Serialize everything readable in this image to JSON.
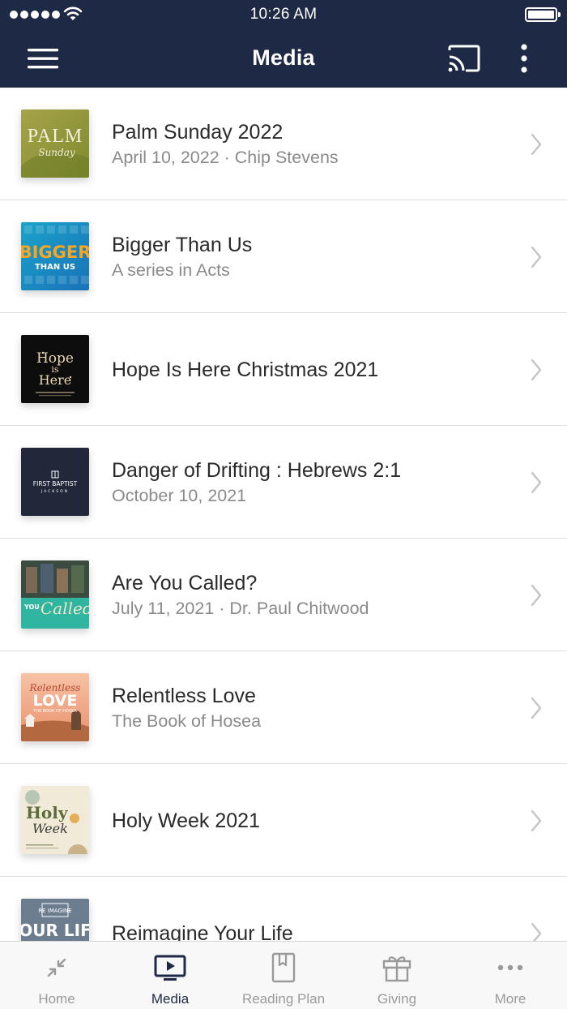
{
  "status_bar": {
    "time": "10:26 AM"
  },
  "nav": {
    "title": "Media"
  },
  "items": [
    {
      "title": "Palm Sunday 2022",
      "subtitle": "April 10, 2022 · Chip Stevens",
      "thumb_text": "PALM",
      "thumb_script": "Sunday"
    },
    {
      "title": "Bigger Than Us",
      "subtitle": "A series in Acts",
      "thumb_text": "BIGGER",
      "thumb_sub": "THAN US"
    },
    {
      "title": "Hope Is Here Christmas 2021",
      "subtitle": "",
      "thumb_text": "Hope",
      "thumb_mid": "is",
      "thumb_script": "Here"
    },
    {
      "title": "Danger of Drifting : Hebrews 2:1",
      "subtitle": "October 10, 2021",
      "thumb_text": "FIRST BAPTIST",
      "thumb_sub": "JACKSON"
    },
    {
      "title": "Are You Called?",
      "subtitle": "July 11, 2021 · Dr. Paul Chitwood",
      "thumb_text": "YOU",
      "thumb_script": "Called"
    },
    {
      "title": "Relentless Love",
      "subtitle": "The Book of Hosea",
      "thumb_script": "Relentless",
      "thumb_text": "LOVE",
      "thumb_sub": "THE BOOK OF HOSEA"
    },
    {
      "title": "Holy Week 2021",
      "subtitle": "",
      "thumb_text": "Holy",
      "thumb_script": "Week"
    },
    {
      "title": "Reimagine Your Life",
      "subtitle": "",
      "thumb_text": "RE IMAGINE",
      "thumb_sub": "OUR LIF"
    }
  ],
  "tabs": [
    {
      "label": "Home",
      "icon": "compress-arrows-icon",
      "active": false
    },
    {
      "label": "Media",
      "icon": "tv-play-icon",
      "active": true
    },
    {
      "label": "Reading Plan",
      "icon": "bookmark-book-icon",
      "active": false
    },
    {
      "label": "Giving",
      "icon": "gift-icon",
      "active": false
    },
    {
      "label": "More",
      "icon": "ellipsis-icon",
      "active": false
    }
  ],
  "colors": {
    "nav_bg": "#1e2a45",
    "active_tab": "#1e2a45",
    "inactive_tab": "#9a9a9a",
    "subtitle": "#8a8a8a"
  }
}
